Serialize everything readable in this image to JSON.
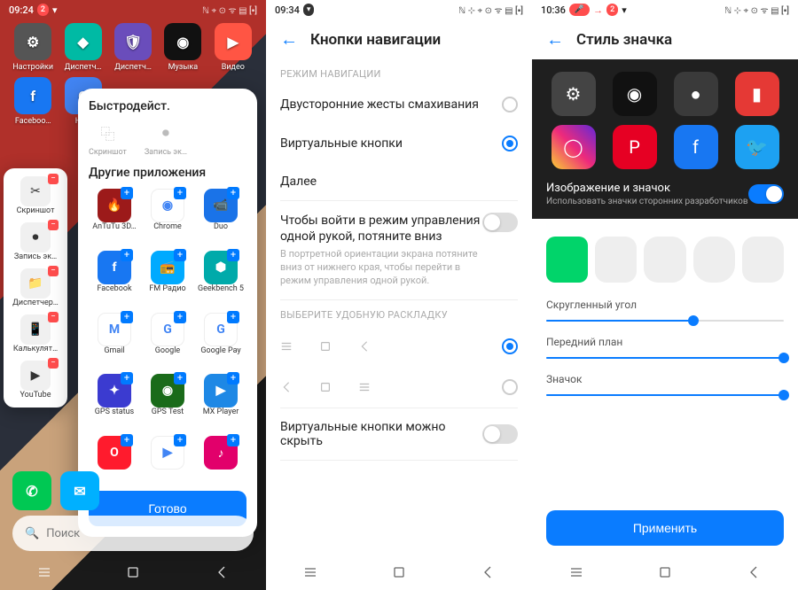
{
  "p1": {
    "time": "09:24",
    "badge": "2",
    "status_icons": "ℕ ⌖ ⊙ ᯤ ▤ [▪]",
    "home_apps": [
      {
        "label": "Настройки",
        "bg": "#555",
        "glyph": "⚙"
      },
      {
        "label": "Диспетч…",
        "bg": "#00baa4",
        "glyph": "◆"
      },
      {
        "label": "Диспетч…",
        "bg": "#6a4dbb",
        "glyph": "🛡"
      },
      {
        "label": "Музыка",
        "bg": "#111",
        "glyph": "◉"
      },
      {
        "label": "Видео",
        "bg": "#ff5544",
        "glyph": "▶"
      },
      {
        "label": "Faceboo…",
        "bg": "#1877f2",
        "glyph": "f"
      },
      {
        "label": "Но…",
        "bg": "#4285f4",
        "glyph": "G"
      }
    ],
    "sidebar": [
      {
        "label": "Скриншот",
        "glyph": "✂"
      },
      {
        "label": "Запись эк…",
        "glyph": "⏺"
      },
      {
        "label": "Диспетчер…",
        "glyph": "📁"
      },
      {
        "label": "Калькулят…",
        "glyph": "📱"
      },
      {
        "label": "YouTube",
        "glyph": "▶"
      }
    ],
    "sheet_title": "Быстродейст.",
    "sheet_quick": [
      {
        "label": "Скриншот",
        "glyph": "⿻"
      },
      {
        "label": "Запись эк…",
        "glyph": "⏺"
      }
    ],
    "sheet_other_title": "Другие приложения",
    "sheet_apps": [
      {
        "label": "AnTuTu 3D…",
        "bg": "#9c1a1a",
        "glyph": "🔥"
      },
      {
        "label": "Chrome",
        "bg": "#fff",
        "glyph": "◉"
      },
      {
        "label": "Duo",
        "bg": "#1a73e8",
        "glyph": "📹"
      },
      {
        "label": "Facebook",
        "bg": "#1877f2",
        "glyph": "f"
      },
      {
        "label": "FM Радио",
        "bg": "#00aaff",
        "glyph": "📻"
      },
      {
        "label": "Geekbench 5",
        "bg": "#0aa",
        "glyph": "⬢"
      },
      {
        "label": "Gmail",
        "bg": "#fff",
        "glyph": "M"
      },
      {
        "label": "Google",
        "bg": "#fff",
        "glyph": "G"
      },
      {
        "label": "Google Pay",
        "bg": "#fff",
        "glyph": "G"
      },
      {
        "label": "GPS status",
        "bg": "#3b3bd0",
        "glyph": "✦"
      },
      {
        "label": "GPS Test",
        "bg": "#1a6b1a",
        "glyph": "◉"
      },
      {
        "label": "MX Player",
        "bg": "#1e88e5",
        "glyph": "▶"
      },
      {
        "label": "",
        "bg": "#ff1b2d",
        "glyph": "O"
      },
      {
        "label": "",
        "bg": "#fff",
        "glyph": "▶"
      },
      {
        "label": "",
        "bg": "#e2006b",
        "glyph": "♪"
      }
    ],
    "done_btn": "Готово",
    "search_placeholder": "Поиск"
  },
  "p2": {
    "time": "09:34",
    "status_icons": "ℕ ⊹ ⌖ ⊙ ᯤ ▤ [▪]",
    "title": "Кнопки навигации",
    "section_mode": "РЕЖИМ НАВИГАЦИИ",
    "opt_gestures": "Двусторонние жесты смахивания",
    "opt_virtual": "Виртуальные кнопки",
    "opt_more": "Далее",
    "onehand_title": "Чтобы войти в режим управления одной рукой, потяните вниз",
    "onehand_desc": "В портретной ориентации экрана потяните вниз от нижнего края, чтобы перейти в режим управления одной рукой.",
    "section_layout": "ВЫБЕРИТЕ УДОБНУЮ РАСКЛАДКУ",
    "hide_title": "Виртуальные кнопки можно скрыть"
  },
  "p3": {
    "time": "10:36",
    "badge": "2",
    "status_icons": "ℕ ⊹ ⌖ ⊙ ᯤ ▤ [▪]",
    "title": "Стиль значка",
    "preview_icons": [
      {
        "bg": "#444",
        "glyph": "⚙"
      },
      {
        "bg": "#111",
        "glyph": "◉"
      },
      {
        "bg": "#3a3a3a",
        "glyph": "●"
      },
      {
        "bg": "#e53935",
        "glyph": "▮"
      },
      {
        "bg": "linear-gradient(45deg,#f9ce34,#ee2a7b,#6228d7)",
        "glyph": "◯"
      },
      {
        "bg": "#e60023",
        "glyph": "P"
      },
      {
        "bg": "#1877f2",
        "glyph": "f"
      },
      {
        "bg": "#1da1f2",
        "glyph": "🐦"
      }
    ],
    "img_title": "Изображение и значок",
    "img_desc": "Использовать значки сторонних разработчиков",
    "slider_corner": "Скругленный угол",
    "slider_fg": "Передний план",
    "slider_icon": "Значок",
    "apply_btn": "Применить",
    "sliders": {
      "corner": 62,
      "fg": 100,
      "icon": 100
    }
  }
}
